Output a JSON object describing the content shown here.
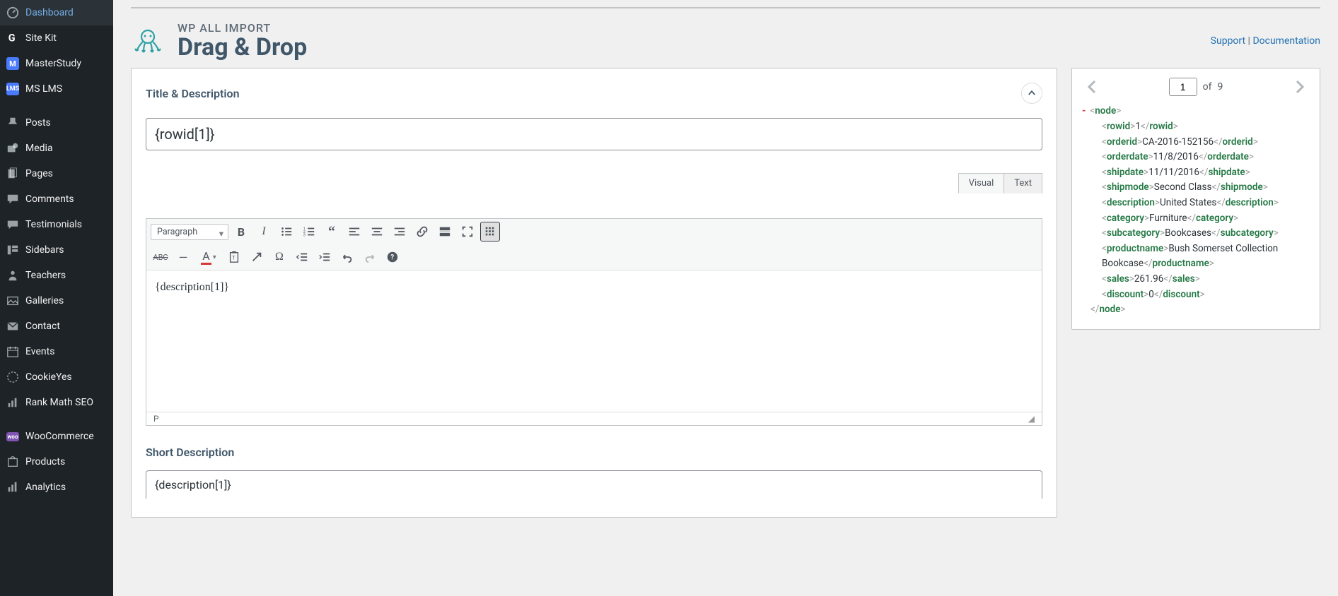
{
  "sidebar": {
    "items": [
      {
        "label": "Dashboard",
        "icon": "dashboard"
      },
      {
        "label": "Site Kit",
        "icon": "sitekit"
      },
      {
        "label": "MasterStudy",
        "icon": "masterstudy"
      },
      {
        "label": "MS LMS",
        "icon": "mslms"
      },
      {
        "label": "Posts",
        "icon": "posts"
      },
      {
        "label": "Media",
        "icon": "media"
      },
      {
        "label": "Pages",
        "icon": "pages"
      },
      {
        "label": "Comments",
        "icon": "comments"
      },
      {
        "label": "Testimonials",
        "icon": "testimonials"
      },
      {
        "label": "Sidebars",
        "icon": "sidebars"
      },
      {
        "label": "Teachers",
        "icon": "teachers"
      },
      {
        "label": "Galleries",
        "icon": "galleries"
      },
      {
        "label": "Contact",
        "icon": "contact"
      },
      {
        "label": "Events",
        "icon": "events"
      },
      {
        "label": "CookieYes",
        "icon": "cookieyes"
      },
      {
        "label": "Rank Math SEO",
        "icon": "rankmath"
      },
      {
        "label": "WooCommerce",
        "icon": "woocommerce"
      },
      {
        "label": "Products",
        "icon": "products"
      },
      {
        "label": "Analytics",
        "icon": "analytics"
      }
    ]
  },
  "header": {
    "subtitle": "WP ALL IMPORT",
    "title": "Drag & Drop",
    "support": "Support",
    "divider": " | ",
    "documentation": "Documentation"
  },
  "panel": {
    "title": "Title & Description",
    "title_input_value": "{rowid[1]}",
    "short_desc_heading": "Short Description",
    "short_desc_value": "{description[1]}"
  },
  "editor": {
    "tabs": {
      "visual": "Visual",
      "text": "Text"
    },
    "paragraph_label": "Paragraph",
    "body": "{description[1]}",
    "status_path": "P"
  },
  "xml_nav": {
    "current": "1",
    "of_label": "of",
    "total": "9"
  },
  "xml": {
    "node_tag": "node",
    "rows": [
      {
        "tag": "rowid",
        "value": "1"
      },
      {
        "tag": "orderid",
        "value": "CA-2016-152156"
      },
      {
        "tag": "orderdate",
        "value": "11/8/2016"
      },
      {
        "tag": "shipdate",
        "value": "11/11/2016"
      },
      {
        "tag": "shipmode",
        "value": "Second Class"
      },
      {
        "tag": "description",
        "value": "United States"
      },
      {
        "tag": "category",
        "value": "Furniture"
      },
      {
        "tag": "subcategory",
        "value": "Bookcases"
      },
      {
        "tag": "productname",
        "value": "Bush Somerset Collection Bookcase"
      },
      {
        "tag": "sales",
        "value": "261.96"
      },
      {
        "tag": "discount",
        "value": "0"
      }
    ]
  }
}
